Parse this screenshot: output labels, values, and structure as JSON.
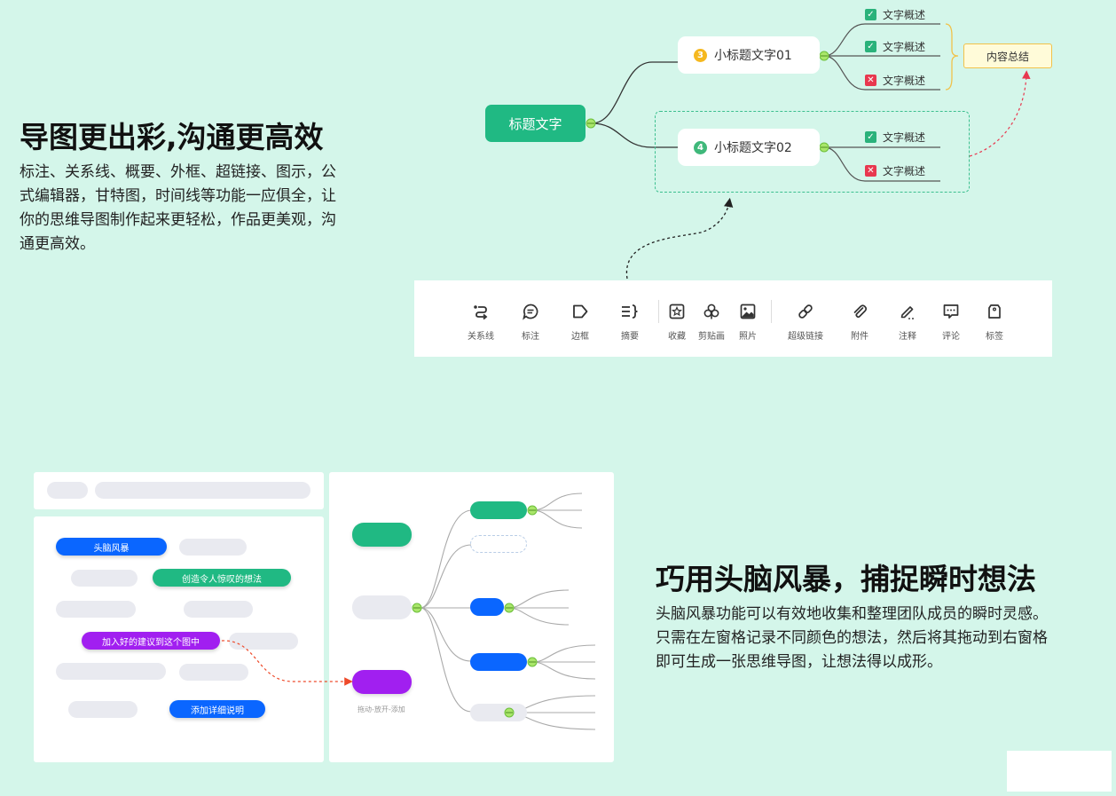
{
  "feature1": {
    "title": "导图更出彩,沟通更高效",
    "lines": [
      "标注、关系线、概要、外框、超链接、图示，公",
      "式编辑器，甘特图，时间线等功能一应俱全，让",
      "你的思维导图制作起来更轻松，作品更美观，沟",
      "通更高效。"
    ]
  },
  "mindmap": {
    "root": "标题文字",
    "topic1": {
      "num": "3",
      "label": "小标题文字01"
    },
    "topic2": {
      "num": "4",
      "label": "小标题文字02"
    },
    "leaf": "文字概述",
    "summary": "内容总结"
  },
  "toolbar": {
    "items": [
      "关系线",
      "标注",
      "边框",
      "摘要",
      "收藏",
      "剪贴画",
      "照片",
      "超级链接",
      "附件",
      "注释",
      "评论",
      "标签"
    ]
  },
  "feature2": {
    "title": "巧用头脑风暴，捕捉瞬时想法",
    "lines": [
      "头脑风暴功能可以有效地收集和整理团队成员的瞬时灵感。",
      "只需在左窗格记录不同颜色的想法，然后将其拖动到右窗格",
      "即可生成一张思维导图，让想法得以成形。"
    ]
  },
  "brainstorm": {
    "chip1": "头脑风暴",
    "chip2": "创造令人惊叹的想法",
    "chip3": "加入好的建议到这个图中",
    "chip4": "添加详细说明",
    "caption": "拖动-放开-添加"
  },
  "colors": {
    "background": "#d4f6ea",
    "green": "#20b983",
    "blue": "#0a66ff",
    "purple": "#a11ff0",
    "check_ok": "#2ab27b",
    "check_no": "#e8384f",
    "number_orange": "#f5b81f"
  }
}
